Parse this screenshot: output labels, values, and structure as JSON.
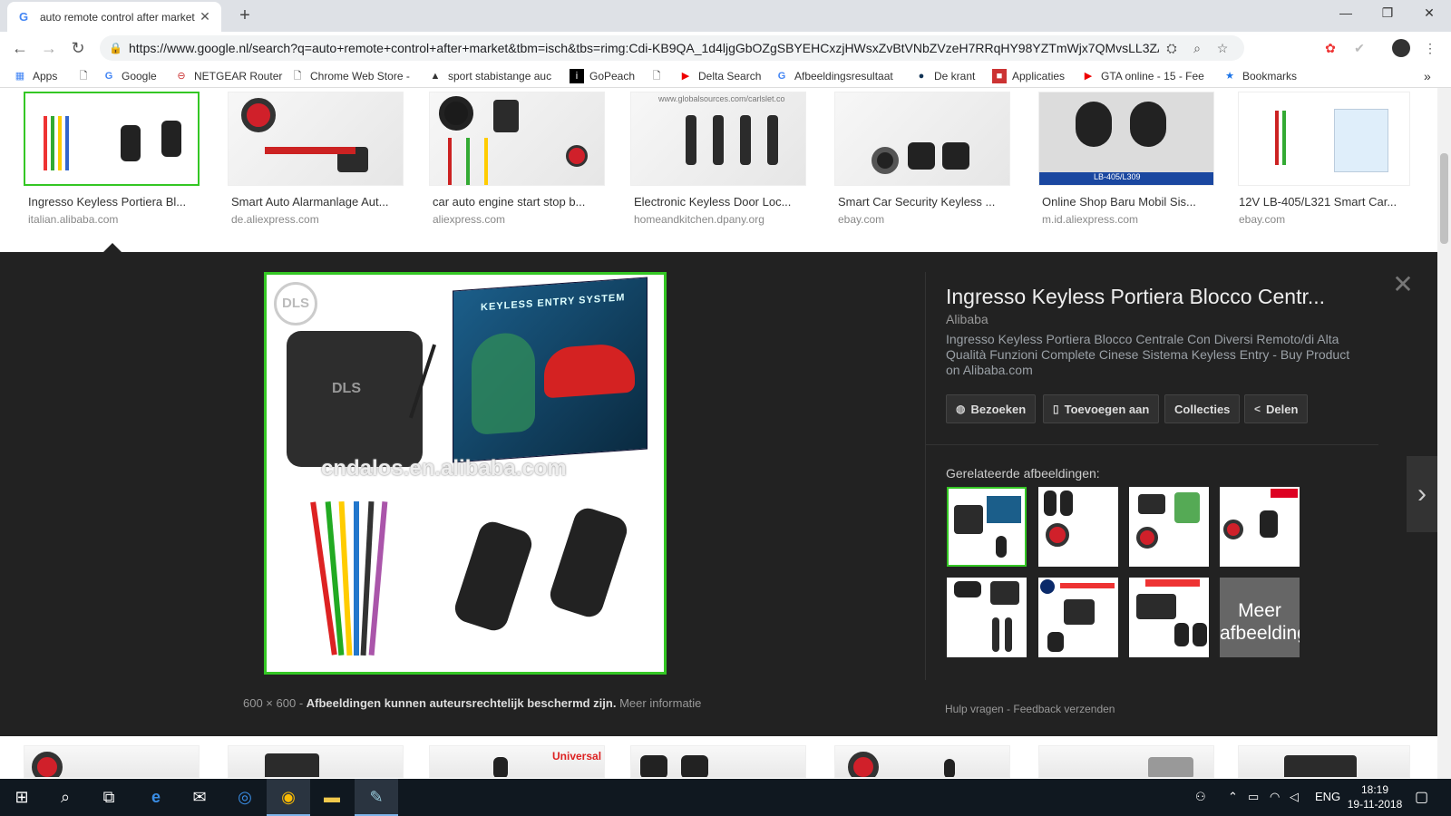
{
  "browser": {
    "tab_title": "auto remote control after market",
    "tab_favicon": "G",
    "url": "https://www.google.nl/search?q=auto+remote+control+after+market&tbm=isch&tbs=rimg:Cdi-KB9QA_1d4ljgGbOZgSBYEHCxzjHWsxZvBtVNbZVzeH7RRqHY98YZTmWjx7QMvsLL3ZAVIFInDjG...",
    "window_controls": {
      "minimize": "—",
      "restore": "❐",
      "close": "✕"
    }
  },
  "bookmarks": [
    {
      "label": "Apps",
      "icon": "apps-grid-icon"
    },
    {
      "label": "",
      "icon": "page-icon"
    },
    {
      "label": "Google",
      "icon": "google-icon"
    },
    {
      "label": "NETGEAR Router",
      "icon": "netgear-icon"
    },
    {
      "label": "Chrome Web Store -",
      "icon": "page-icon"
    },
    {
      "label": "sport stabistange auc",
      "icon": "shop-icon"
    },
    {
      "label": "GoPeach",
      "icon": "gopeach-icon"
    },
    {
      "label": "",
      "icon": "page-icon"
    },
    {
      "label": "Delta Search",
      "icon": "youtube-icon"
    },
    {
      "label": "Afbeeldingsresultaat",
      "icon": "google-icon"
    },
    {
      "label": "De krant",
      "icon": "krant-icon"
    },
    {
      "label": "Applicaties",
      "icon": "app-icon"
    },
    {
      "label": "GTA online - 15 - Fee",
      "icon": "youtube-icon"
    },
    {
      "label": "Bookmarks",
      "icon": "star-icon"
    }
  ],
  "thumbnails": [
    {
      "title": "Ingresso Keyless Portiera Bl...",
      "source": "italian.alibaba.com"
    },
    {
      "title": "Smart Auto Alarmanlage Aut...",
      "source": "de.aliexpress.com"
    },
    {
      "title": "car auto engine start stop b...",
      "source": "aliexpress.com"
    },
    {
      "title": "Electronic Keyless Door Loc...",
      "source": "homeandkitchen.dpany.org"
    },
    {
      "title": "Smart Car Security Keyless ...",
      "source": "ebay.com"
    },
    {
      "title": "Online Shop Baru Mobil Sis...",
      "source": "m.id.aliexpress.com"
    },
    {
      "title": "12V LB-405/L321 Smart Car...",
      "source": "ebay.com"
    }
  ],
  "thumb_overlays": {
    "globalsources": "www.globalsources.com/carlslet.co",
    "lb405": "LB-405/L309",
    "lower_universal": "Universal"
  },
  "preview": {
    "watermark": "cndalos.en.alibaba.com",
    "logo_text": "DLS",
    "box_text": "KEYLESS ENTRY SYSTEM",
    "dimensions": "600 × 600",
    "copyright": "Afbeeldingen kunnen auteursrechtelijk beschermd zijn.",
    "more_info": "Meer informatie"
  },
  "info": {
    "title": "Ingresso Keyless Portiera Blocco Centr...",
    "site": "Alibaba",
    "description": "Ingresso Keyless Portiera Blocco Centrale Con Diversi Remoto/di Alta Qualità Funzioni Complete Cinese Sistema Keyless Entry - Buy Product on Alibaba.com",
    "buttons": {
      "visit": "Bezoeken",
      "save": "Toevoegen aan",
      "collections": "Collecties",
      "share": "Delen"
    },
    "related_title": "Gerelateerde afbeeldingen:",
    "more_images": "Meer afbeeldinge",
    "help": "Hulp vragen",
    "feedback": "Feedback verzenden"
  },
  "taskbar": {
    "language": "ENG",
    "time": "18:19",
    "date": "19-11-2018"
  }
}
